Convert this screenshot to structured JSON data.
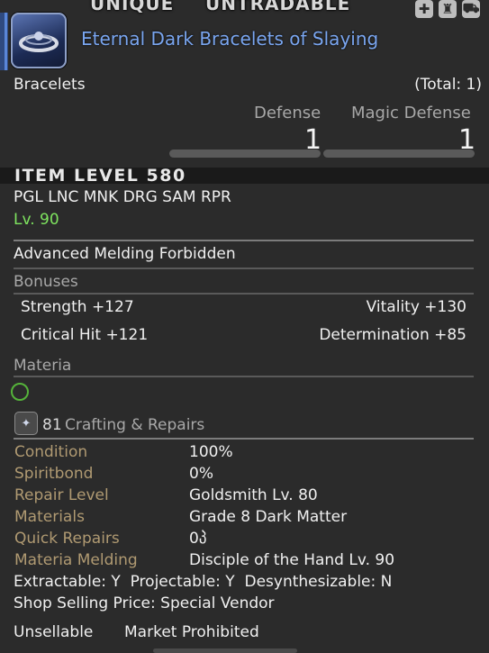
{
  "flags": {
    "unique": "UNIQUE",
    "untradable": "UNTRADABLE"
  },
  "item": {
    "name": "Eternal Dark Bracelets of Slaying",
    "category": "Bracelets",
    "total": "(Total: 1)",
    "icon": "bracelet-item-icon"
  },
  "stats": {
    "defense_label": "Defense",
    "defense_value": "1",
    "magic_defense_label": "Magic Defense",
    "magic_defense_value": "1"
  },
  "item_level": "ITEM LEVEL 580",
  "jobs": "PGL LNC MNK DRG SAM RPR",
  "level": "Lv. 90",
  "melding": "Advanced Melding Forbidden",
  "bonuses": {
    "header": "Bonuses",
    "strength": "Strength +127",
    "vitality": "Vitality +130",
    "critical_hit": "Critical Hit +121",
    "determination": "Determination +85"
  },
  "materia": {
    "header": "Materia",
    "slot_color": "#55b33a"
  },
  "crafting": {
    "header": "Crafting & Repairs",
    "number": "81",
    "rows": [
      {
        "label": "Condition",
        "value": "100%"
      },
      {
        "label": "Spiritbond",
        "value": "0%"
      },
      {
        "label": "Repair Level",
        "value": "Goldsmith Lv. 80"
      },
      {
        "label": "Materials",
        "value": "Grade 8 Dark Matter"
      },
      {
        "label": "Quick Repairs",
        "value": "0პ"
      },
      {
        "label": "Materia Melding",
        "value": "Disciple of the Hand Lv. 90"
      }
    ]
  },
  "extract_line": "Extractable: Y  Projectable: Y  Desynthesizable: N",
  "shop_line": "Shop Selling Price: Special Vendor",
  "footer": {
    "unsellable": "Unsellable",
    "market": "Market Prohibited"
  },
  "colors": {
    "item_name": "#7aa6f0",
    "level_green": "#7ee35f",
    "label_gold": "#b09a72"
  }
}
